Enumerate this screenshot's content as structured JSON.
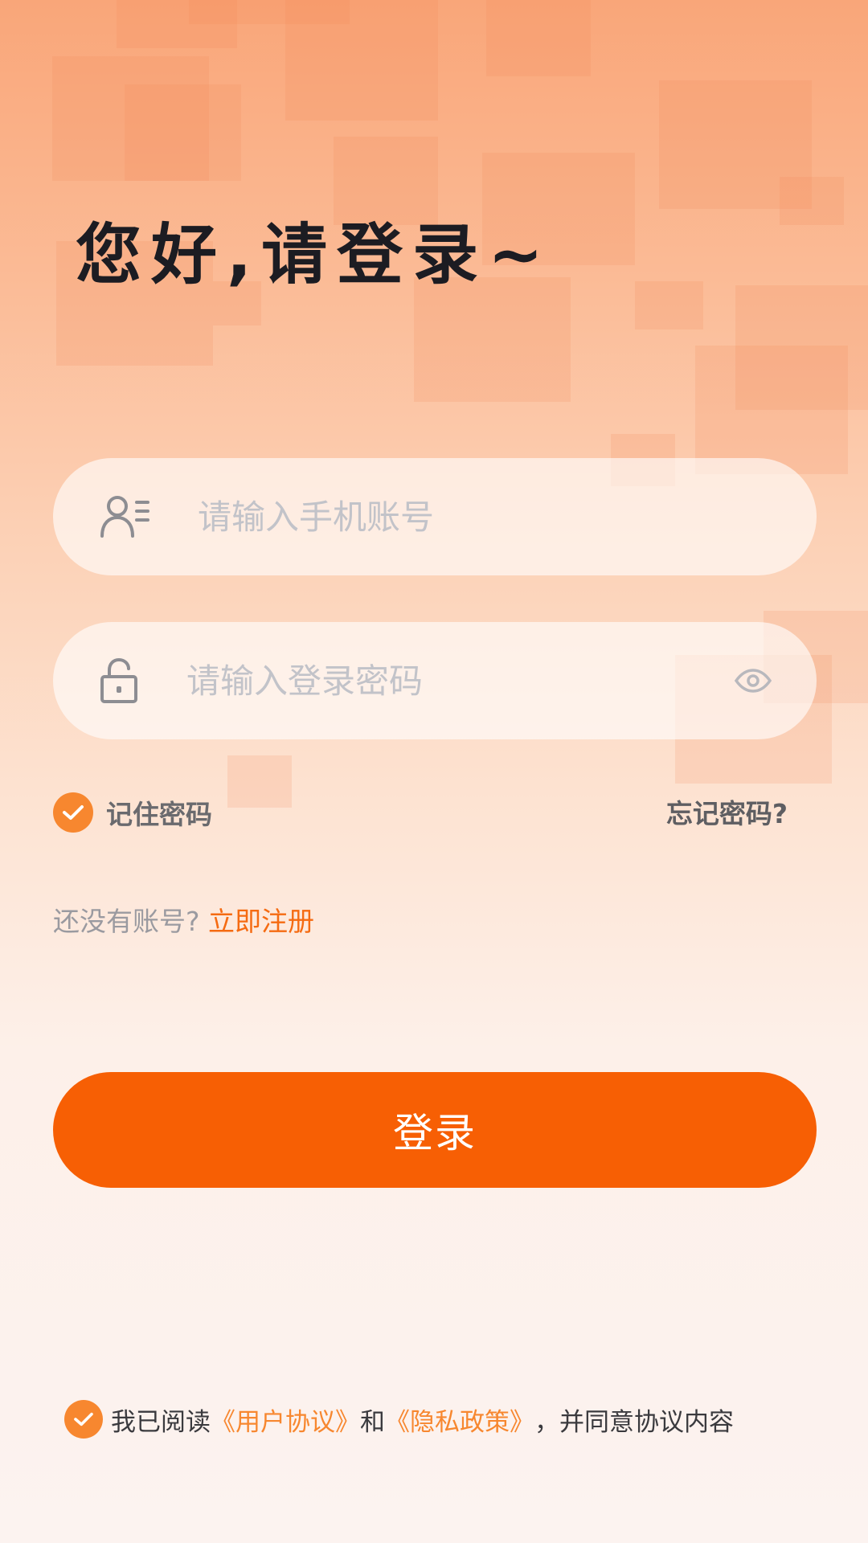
{
  "greeting": "您好,请登录~",
  "account": {
    "placeholder": "请输入手机账号",
    "icon": "user-list-icon"
  },
  "password": {
    "placeholder": "请输入登录密码",
    "icon": "lock-icon",
    "toggle_icon": "eye-icon"
  },
  "remember": {
    "label": "记住密码",
    "checked": true
  },
  "forgot_label": "忘记密码?",
  "register": {
    "prompt": "还没有账号?",
    "link": "立即注册"
  },
  "login_button": "登录",
  "agreement": {
    "checked": true,
    "prefix": "我已阅读",
    "user_agreement": "《用户协议》",
    "and": "和",
    "privacy_policy": "《隐私政策》",
    "suffix": "，并同意协议内容"
  },
  "colors": {
    "accent": "#f75f04",
    "check": "#f7872f",
    "link": "#f56b12"
  }
}
